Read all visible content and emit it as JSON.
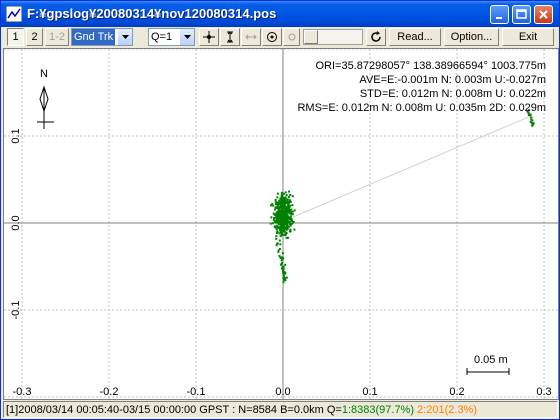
{
  "window": {
    "title": "F:¥gpslog¥20080314¥nov120080314.pos"
  },
  "toolbar": {
    "btn1": "1",
    "btn2": "2",
    "btn12": "1-2",
    "plot_type": "Gnd Trk",
    "quality": "Q=1",
    "read": "Read...",
    "option": "Option...",
    "exit": "Exit"
  },
  "plot": {
    "compass_label": "N",
    "stats": {
      "ori": "ORI=35.87298057° 138.38966594° 1003.775m",
      "ave": "AVE=E:-0.001m N: 0.003m U:-0.027m",
      "std": "STD=E: 0.012m N: 0.008m U: 0.022m",
      "rms": "RMS=E: 0.012m N: 0.008m U: 0.035m 2D: 0.029m"
    },
    "y_ticks": [
      "0.1",
      "0.0",
      "-0.1"
    ],
    "x_ticks": [
      "-0.3",
      "-0.2",
      "-0.1",
      "0.0",
      "0.1",
      "0.2",
      "0.3"
    ],
    "scale_bar": "0.05 m",
    "colors": {
      "points": "#008000",
      "grid": "#c0c0c0",
      "axis": "#808080"
    }
  },
  "status": {
    "prefix": "[1]2008/03/14 00:05:40-03/15 00:00:00 GPST : N=8584 B=0.0km Q=",
    "q1": "1:8383(97.7%)",
    "q2": "2:201(2.3%)"
  }
}
